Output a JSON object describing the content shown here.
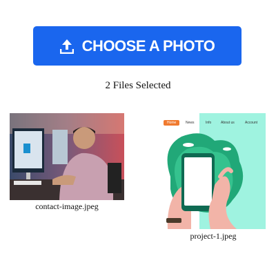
{
  "upload": {
    "button_label": "CHOOSE A PHOTO",
    "button_icon": "upload-icon",
    "accent": "#1a66ee"
  },
  "selection": {
    "status": "2 Files Selected"
  },
  "files": [
    {
      "name": "contact-image.jpeg"
    },
    {
      "name": "project-1.jpeg",
      "mock_nav": [
        "Home",
        "News",
        "Info",
        "About us",
        "Account"
      ]
    }
  ]
}
